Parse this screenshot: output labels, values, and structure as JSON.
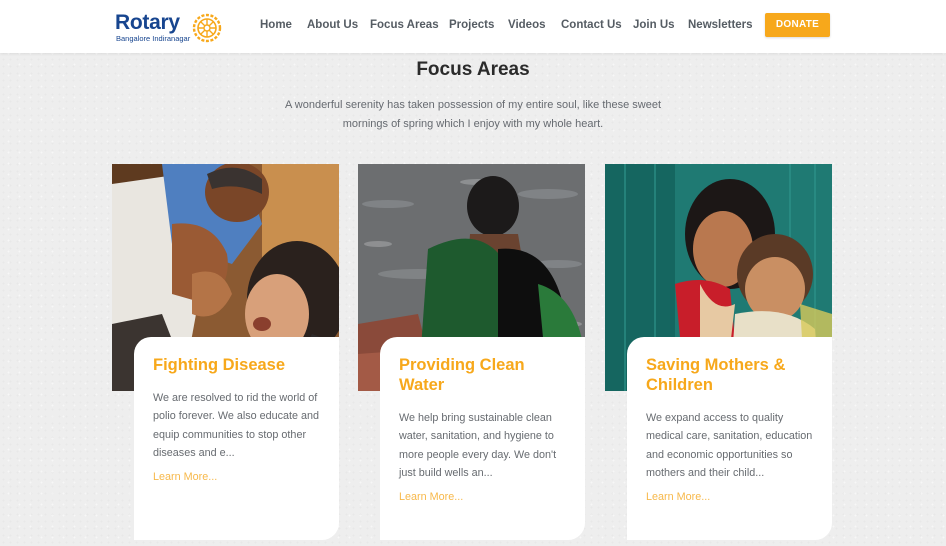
{
  "header": {
    "logo_word": "Rotary",
    "logo_subtitle": "Bangalore Indiranagar",
    "nav": [
      "Home",
      "About Us",
      "Focus Areas",
      "Projects",
      "Videos",
      "Contact Us",
      "Join Us",
      "Newsletters"
    ],
    "donate_label": "DONATE"
  },
  "section": {
    "title": "Focus Areas",
    "intro": "A wonderful serenity has taken possession of my entire soul, like these sweet mornings of spring which I enjoy with my whole heart."
  },
  "cards": [
    {
      "title": "Fighting Disease",
      "text": "We are resolved to rid the world of polio forever. We also educate and equip communities to stop other diseases and e...",
      "link": "Learn More..."
    },
    {
      "title": "Providing Clean Water",
      "text": "We help bring sustainable clean water, sanitation, and hygiene to more people every day. We don't just build wells an...",
      "link": "Learn More..."
    },
    {
      "title": "Saving Mothers & Children",
      "text": "We expand access to quality medical care, sanitation, education and economic opportunities so mothers and their child...",
      "link": "Learn More..."
    }
  ],
  "colors": {
    "brand_blue": "#17458f",
    "brand_gold": "#f7a81b",
    "nav_text": "#555c63"
  }
}
